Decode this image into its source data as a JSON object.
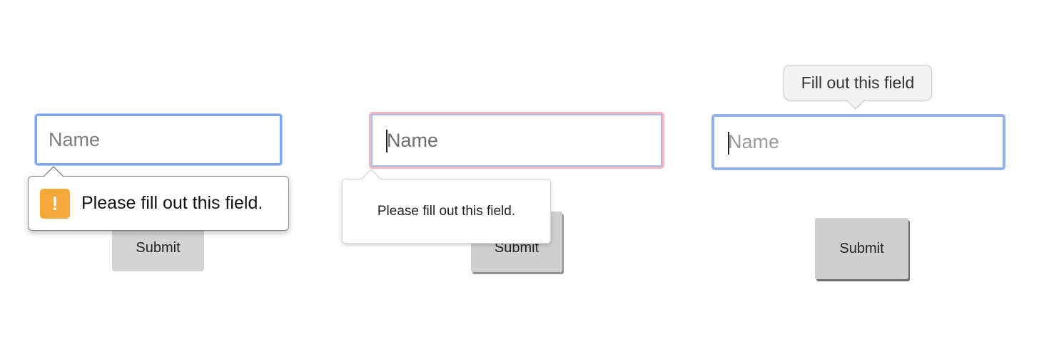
{
  "panels": [
    {
      "style": "chrome",
      "input": {
        "placeholder": "Name",
        "value": ""
      },
      "submit_label": "Submit",
      "tooltip": {
        "message": "Please fill out this field.",
        "icon": "warning-exclamation-icon",
        "icon_glyph": "!",
        "icon_color": "#f4a93a"
      }
    },
    {
      "style": "firefox",
      "input": {
        "placeholder": "Name",
        "value": ""
      },
      "submit_label": "Submit",
      "tooltip": {
        "message": "Please fill out this field."
      }
    },
    {
      "style": "safari",
      "input": {
        "placeholder": "Name",
        "value": ""
      },
      "submit_label": "Submit",
      "tooltip": {
        "message": "Fill out this field"
      }
    }
  ],
  "colors": {
    "focus_blue": "#7fa6f0",
    "invalid_red_glow": "#f6b8be",
    "button_gray": "#d4d4d4",
    "warning_orange": "#f4a93a"
  }
}
